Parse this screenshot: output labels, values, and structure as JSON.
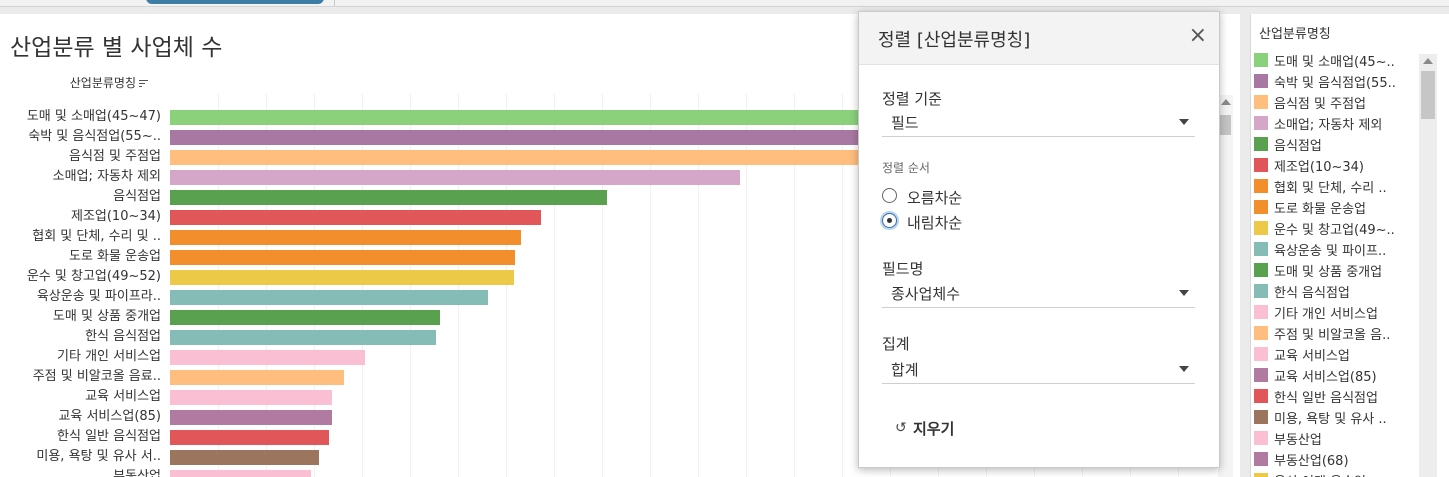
{
  "colors": {
    "selection": "#3c6fa4"
  },
  "sheet": {
    "title": "산업분류 별 사업체 수",
    "column_header": "산업분류명칭"
  },
  "chart_data": {
    "type": "bar",
    "orientation": "horizontal",
    "title": "산업분류 별 사업체 수",
    "ylabel": "산업분류명칭",
    "xlabel": "",
    "grid": true,
    "categories": [
      "도매 및 소매업(45~47)",
      "숙박 및 음식점업(55~..",
      "음식점 및 주점업",
      "소매업; 자동차 제외",
      "음식점업",
      "제조업(10~34)",
      "협회 및 단체, 수리 및 ..",
      "도로 화물 운송업",
      "운수 및 창고업(49~52)",
      "육상운송 및 파이프라..",
      "도매 및 상품 중개업",
      "한식 음식점업",
      "기타 개인 서비스업",
      "주점 및 비알코올 음료..",
      "교육 서비스업",
      "교육 서비스업(85)",
      "한식 일반 음식점업",
      "미용, 욕탕 및 유사 서..",
      "부동산업"
    ],
    "values": [
      1000,
      900,
      870,
      651,
      499,
      424,
      401,
      394,
      393,
      363,
      308,
      304,
      223,
      199,
      185,
      185,
      182,
      170,
      161
    ],
    "bar_colors": [
      "#8bd17c",
      "#a878a3",
      "#ffbe7d",
      "#d4a6c8",
      "#59a14f",
      "#e15759",
      "#f28e2b",
      "#f28e2b",
      "#edc948",
      "#86bcb6",
      "#59a14f",
      "#86bcb6",
      "#fabfd2",
      "#ffbe7d",
      "#fabfd2",
      "#b07aa1",
      "#e15759",
      "#9c755f",
      "#fabfd2"
    ]
  },
  "legend": {
    "title": "산업분류명칭",
    "items": [
      {
        "label": "도매 및 소매업(45~..",
        "color": "#8bd17c"
      },
      {
        "label": "숙박 및 음식점업(55..",
        "color": "#a878a3"
      },
      {
        "label": "음식점 및 주점업",
        "color": "#ffbe7d"
      },
      {
        "label": "소매업; 자동차 제외",
        "color": "#d4a6c8"
      },
      {
        "label": "음식점업",
        "color": "#59a14f"
      },
      {
        "label": "제조업(10~34)",
        "color": "#e15759"
      },
      {
        "label": "협회 및 단체, 수리 ..",
        "color": "#f28e2b"
      },
      {
        "label": "도로 화물 운송업",
        "color": "#f28e2b"
      },
      {
        "label": "운수 및 창고업(49~..",
        "color": "#edc948"
      },
      {
        "label": "육상운송 및 파이프..",
        "color": "#86bcb6"
      },
      {
        "label": "도매 및 상품 중개업",
        "color": "#59a14f"
      },
      {
        "label": "한식 음식점업",
        "color": "#86bcb6"
      },
      {
        "label": "기타 개인 서비스업",
        "color": "#fabfd2"
      },
      {
        "label": "주점 및 비알코올 음..",
        "color": "#ffbe7d"
      },
      {
        "label": "교육 서비스업",
        "color": "#fabfd2"
      },
      {
        "label": "교육 서비스업(85)",
        "color": "#b07aa1"
      },
      {
        "label": "한식 일반 음식점업",
        "color": "#e15759"
      },
      {
        "label": "미용, 욕탕 및 유사 ..",
        "color": "#9c755f"
      },
      {
        "label": "부동산업",
        "color": "#fabfd2"
      },
      {
        "label": "부동산업(68)",
        "color": "#b07aa1"
      },
      {
        "label": "육상 여객 운송업",
        "color": "#edc948"
      }
    ]
  },
  "dialog": {
    "title": "정렬 [산업분류명칭]",
    "close_icon": "close-icon",
    "sort_by_label": "정렬 기준",
    "sort_by_value": "필드",
    "sort_order_label": "정렬 순서",
    "ascending_label": "오름차순",
    "descending_label": "내림차순",
    "selected_order": "descending",
    "field_name_label": "필드명",
    "field_name_value": "종사업체수",
    "aggregation_label": "집계",
    "aggregation_value": "합계",
    "clear_icon": "undo-icon",
    "clear_label": "지우기"
  }
}
